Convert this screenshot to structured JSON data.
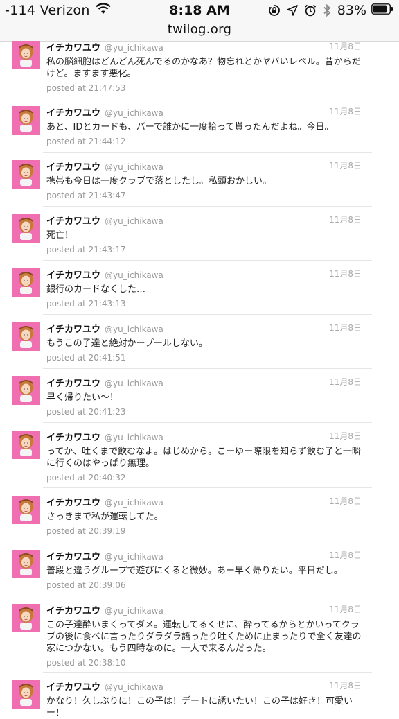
{
  "status_bar": {
    "carrier": "-114 Verizon",
    "time": "8:18 AM",
    "battery": "83%"
  },
  "browser": {
    "url": "twilog.org"
  },
  "tweets": [
    {
      "author": "イチカワユウ",
      "handle": "@yu_ichikawa",
      "date": "11月8日",
      "text": "私の脳細胞はどんどん死んでるのかなあ？物忘れとかヤバいレベル。昔からだけど。ますます悪化。",
      "posted": "posted at 21:47:53"
    },
    {
      "author": "イチカワユウ",
      "handle": "@yu_ichikawa",
      "date": "11月8日",
      "text": "あと、IDとカードも、バーで誰かに一度拾って貰ったんだよね。今日。",
      "posted": "posted at 21:44:12"
    },
    {
      "author": "イチカワユウ",
      "handle": "@yu_ichikawa",
      "date": "11月8日",
      "text": "携帯も今日は一度クラブで落としたし。私頭おかしい。",
      "posted": "posted at 21:43:47"
    },
    {
      "author": "イチカワユウ",
      "handle": "@yu_ichikawa",
      "date": "11月8日",
      "text": "死亡！",
      "posted": "posted at 21:43:17"
    },
    {
      "author": "イチカワユウ",
      "handle": "@yu_ichikawa",
      "date": "11月8日",
      "text": "銀行のカードなくした…",
      "posted": "posted at 21:43:13"
    },
    {
      "author": "イチカワユウ",
      "handle": "@yu_ichikawa",
      "date": "11月8日",
      "text": "もうこの子達と絶対かープールしない。",
      "posted": "posted at 20:41:51"
    },
    {
      "author": "イチカワユウ",
      "handle": "@yu_ichikawa",
      "date": "11月8日",
      "text": "早く帰りたい〜！",
      "posted": "posted at 20:41:23"
    },
    {
      "author": "イチカワユウ",
      "handle": "@yu_ichikawa",
      "date": "11月8日",
      "text": "ってか、吐くまで飲むなよ。はじめから。こーゆー際限を知らず飲む子と一瞬に行くのはやっぱり無理。",
      "posted": "posted at 20:40:32"
    },
    {
      "author": "イチカワユウ",
      "handle": "@yu_ichikawa",
      "date": "11月8日",
      "text": "さっきまで私が運転してた。",
      "posted": "posted at 20:39:19"
    },
    {
      "author": "イチカワユウ",
      "handle": "@yu_ichikawa",
      "date": "11月8日",
      "text": "普段と違うグループで遊びにくると微妙。あー早く帰りたい。平日だし。",
      "posted": "posted at 20:39:06"
    },
    {
      "author": "イチカワユウ",
      "handle": "@yu_ichikawa",
      "date": "11月8日",
      "text": "この子達酔いまくってダメ。運転してるくせに、酔ってるからとかいってクラブの後に食べに言ったりダラダラ語ったり吐くために止まったりで全く友達の家につかない。もう四時なのに。一人で来るんだった。",
      "posted": "posted at 20:38:10"
    },
    {
      "author": "イチカワユウ",
      "handle": "@yu_ichikawa",
      "date": "11月8日",
      "text": "かなり！久しぶりに！この子は！デートに誘いたい！この子は好き！可愛いー！",
      "posted": ""
    }
  ]
}
